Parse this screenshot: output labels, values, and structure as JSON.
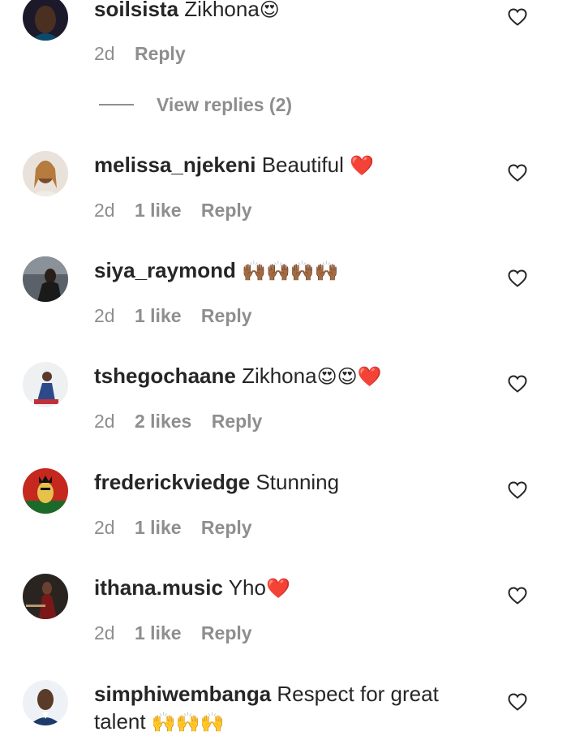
{
  "comments": [
    {
      "username": "soilsista",
      "text": "Zikhona",
      "emoji": "😍",
      "time": "2d",
      "likes": "",
      "reply": "Reply"
    },
    {
      "username": "melissa_njekeni",
      "text": "Beautiful",
      "emoji": "❤️",
      "time": "2d",
      "likes": "1 like",
      "reply": "Reply"
    },
    {
      "username": "siya_raymond",
      "text": "",
      "emoji": "🙌🏾🙌🏾🙌🏾🙌🏾",
      "time": "2d",
      "likes": "1 like",
      "reply": "Reply"
    },
    {
      "username": "tshegochaane",
      "text": "Zikhona",
      "emoji": "😍😍❤️",
      "time": "2d",
      "likes": "2 likes",
      "reply": "Reply"
    },
    {
      "username": "frederickviedge",
      "text": "Stunning",
      "emoji": "",
      "time": "2d",
      "likes": "1 like",
      "reply": "Reply"
    },
    {
      "username": "ithana.music",
      "text": "Yho",
      "emoji": "❤️",
      "time": "2d",
      "likes": "1 like",
      "reply": "Reply"
    },
    {
      "username": "simphiwembanga",
      "text": "Respect for great talent",
      "emoji": "🙌🙌🙌",
      "time": "",
      "likes": "",
      "reply": ""
    }
  ],
  "view_replies": "View replies (2)",
  "colors": {
    "text": "#262626",
    "muted": "#8e8e8e",
    "background": "#ffffff"
  },
  "icons": {
    "like": "heart-outline-icon"
  }
}
